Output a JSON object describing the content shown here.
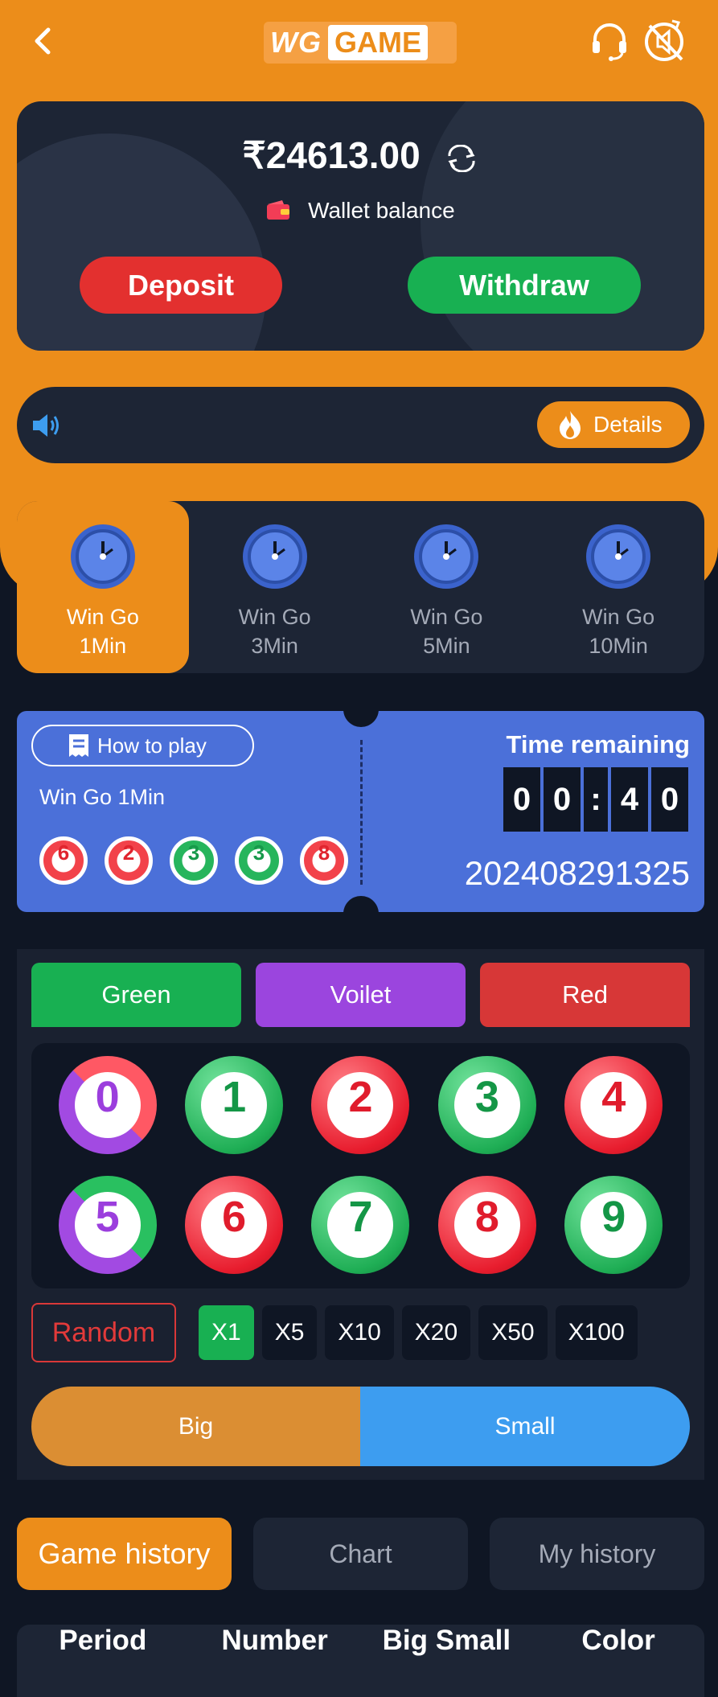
{
  "header": {
    "logo_part1": "WG",
    "logo_part2": "GAME"
  },
  "wallet": {
    "balance": "₹24613.00",
    "label": "Wallet balance",
    "deposit": "Deposit",
    "withdraw": "Withdraw"
  },
  "notice": {
    "details": "Details"
  },
  "game_tabs": [
    {
      "line1": "Win Go",
      "line2": "1Min"
    },
    {
      "line1": "Win Go",
      "line2": "3Min"
    },
    {
      "line1": "Win Go",
      "line2": "5Min"
    },
    {
      "line1": "Win Go",
      "line2": "10Min"
    }
  ],
  "ticket": {
    "how_to_play": "How to play",
    "game_name": "Win Go 1Min",
    "recent_results": [
      "6",
      "2",
      "3",
      "3",
      "8"
    ],
    "time_label": "Time remaining",
    "timer": [
      "0",
      "0",
      ":",
      "4",
      "0"
    ],
    "period": "202408291325"
  },
  "colors": {
    "green": "Green",
    "violet": "Voilet",
    "red": "Red"
  },
  "numbers": [
    "0",
    "1",
    "2",
    "3",
    "4",
    "5",
    "6",
    "7",
    "8",
    "9"
  ],
  "multipliers": {
    "random": "Random",
    "options": [
      "X1",
      "X5",
      "X10",
      "X20",
      "X50",
      "X100"
    ]
  },
  "size": {
    "big": "Big",
    "small": "Small"
  },
  "history_tabs": {
    "game_history": "Game history",
    "chart": "Chart",
    "my_history": "My history"
  },
  "table_headers": {
    "period": "Period",
    "number": "Number",
    "big_small": "Big Small",
    "color": "Color"
  },
  "theme": {
    "accent": "#ec8d1a",
    "green": "#18b052",
    "violet": "#9b45de",
    "red": "#d73737",
    "blue": "#3d9df0"
  }
}
